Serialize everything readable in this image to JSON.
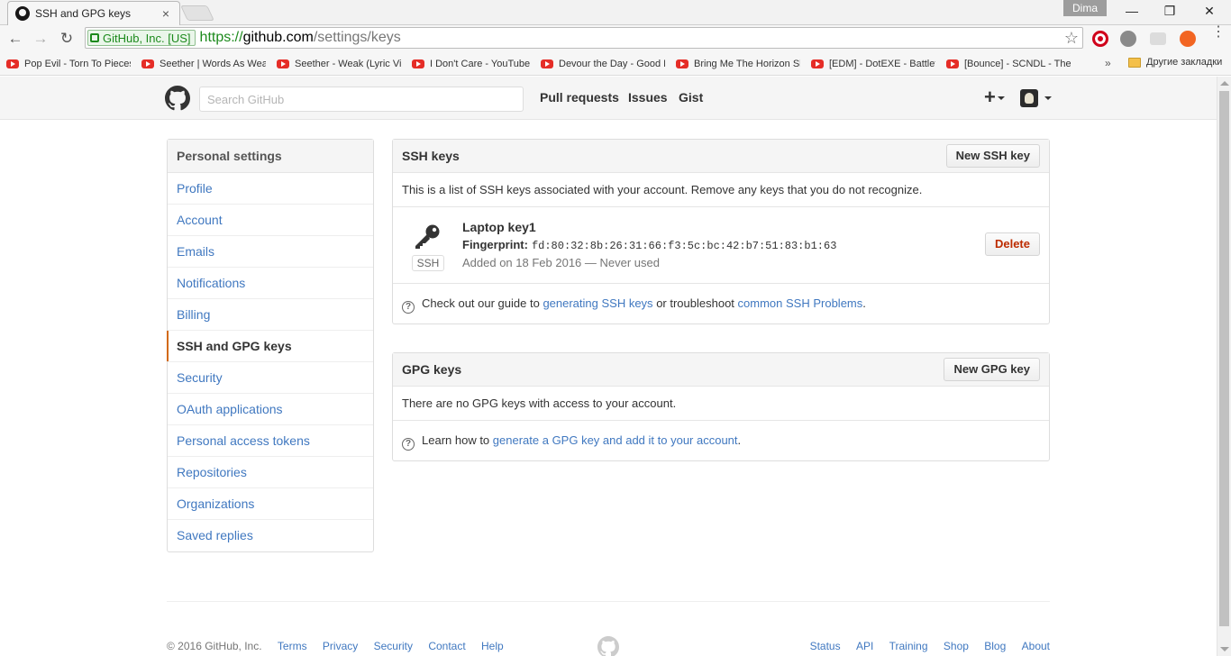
{
  "browser": {
    "tab_title": "SSH and GPG keys",
    "tab_close": "×",
    "user_label": "Dima",
    "window_controls": {
      "minimize": "—",
      "restore": "❐",
      "close": "✕"
    },
    "nav": {
      "back": "←",
      "forward": "→",
      "reload": "↻"
    },
    "ev_label": "GitHub, Inc. [US]",
    "url_scheme": "https://",
    "url_host": "github.com",
    "url_path": "/settings/keys",
    "star": "☆",
    "menu_dots": "⋮",
    "bookmarks": [
      "Pop Evil - Torn To Pieces",
      "Seether | Words As Weapons",
      "Seether - Weak (Lyric Video)",
      "I Don't Care - YouTube",
      "Devour the Day - Good Man",
      "Bring Me The Horizon Sleepwalking",
      "[EDM] - DotEXE - Battlefield",
      "[Bounce] - SCNDL - The Kick"
    ],
    "bookmarks_more": "»",
    "bookmarks_folder": "Другие закладки",
    "icons": {
      "tab_favicon": "github-favicon-icon",
      "youtube": "youtube-icon",
      "folder": "folder-icon",
      "lock": "lock-icon"
    }
  },
  "github": {
    "search_placeholder": "Search GitHub",
    "nav": [
      "Pull requests",
      "Issues",
      "Gist"
    ],
    "plus": "+",
    "colors": {
      "link": "#4078c0",
      "accent": "#d26911",
      "danger": "#bd2c00"
    }
  },
  "sidebar": {
    "heading": "Personal settings",
    "items": [
      {
        "label": "Profile"
      },
      {
        "label": "Account"
      },
      {
        "label": "Emails"
      },
      {
        "label": "Notifications"
      },
      {
        "label": "Billing"
      },
      {
        "label": "SSH and GPG keys",
        "selected": true
      },
      {
        "label": "Security"
      },
      {
        "label": "OAuth applications"
      },
      {
        "label": "Personal access tokens"
      },
      {
        "label": "Repositories"
      },
      {
        "label": "Organizations"
      },
      {
        "label": "Saved replies"
      }
    ]
  },
  "ssh": {
    "title": "SSH keys",
    "new_button": "New SSH key",
    "description": "This is a list of SSH keys associated with your account. Remove any keys that you do not recognize.",
    "key": {
      "name": "Laptop key1",
      "fingerprint_label": "Fingerprint:",
      "fingerprint": "fd:80:32:8b:26:31:66:f3:5c:bc:42:b7:51:83:b1:63",
      "added": "Added on 18 Feb 2016 — Never used",
      "badge": "SSH",
      "delete_button": "Delete"
    },
    "help": {
      "prefix": "Check out our guide to",
      "link1": "generating SSH keys",
      "middle": "or troubleshoot",
      "link2": "common SSH Problems",
      "suffix": "."
    }
  },
  "gpg": {
    "title": "GPG keys",
    "new_button": "New GPG key",
    "empty": "There are no GPG keys with access to your account.",
    "help": {
      "prefix": "Learn how to",
      "link": "generate a GPG key and add it to your account",
      "suffix": "."
    }
  },
  "footer": {
    "copyright": "© 2016 GitHub, Inc.",
    "left_links": [
      "Terms",
      "Privacy",
      "Security",
      "Contact",
      "Help"
    ],
    "right_links": [
      "Status",
      "API",
      "Training",
      "Shop",
      "Blog",
      "About"
    ]
  }
}
